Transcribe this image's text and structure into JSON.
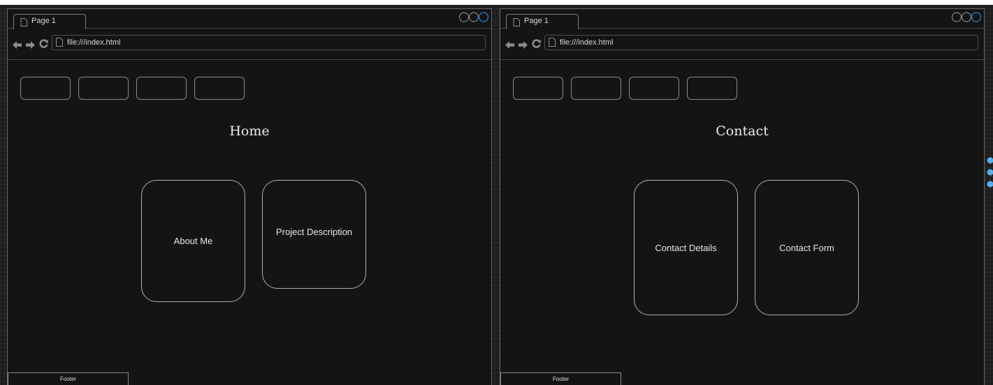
{
  "colors": {
    "background": "#1c1c1c",
    "window": "#141414",
    "border": "#6a6a6a",
    "text": "#e8e8e8",
    "accent": "#2a7fd4",
    "handle": "#5aaee8"
  },
  "left_window": {
    "tab": {
      "label": "Page 1",
      "icon": "page-icon"
    },
    "window_controls": [
      "circle-icon",
      "circle-icon",
      "circle-icon"
    ],
    "address_bar": {
      "url": "file:///index.html"
    },
    "nav_icons": [
      "back-arrow-icon",
      "forward-arrow-icon",
      "refresh-icon"
    ],
    "page_title": "Home",
    "cards": [
      {
        "label": "About Me"
      },
      {
        "label": "Project Description"
      }
    ],
    "footer": "Footer"
  },
  "right_window": {
    "tab": {
      "label": "Page 1",
      "icon": "page-icon"
    },
    "window_controls": [
      "circle-icon",
      "circle-icon",
      "circle-icon"
    ],
    "address_bar": {
      "url": "file:///index.html"
    },
    "nav_icons": [
      "back-arrow-icon",
      "forward-arrow-icon",
      "refresh-icon"
    ],
    "page_title": "Contact",
    "cards": [
      {
        "label": "Contact Details"
      },
      {
        "label": "Contact Form"
      }
    ],
    "footer": "Footer"
  }
}
